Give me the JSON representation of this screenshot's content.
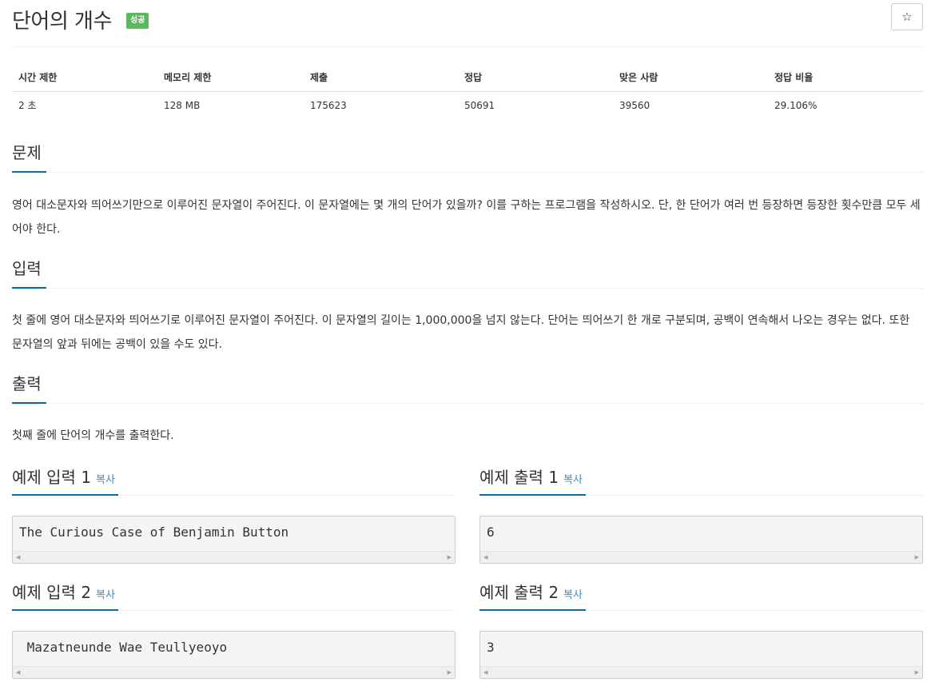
{
  "header": {
    "title": "단어의 개수",
    "badge": "성공",
    "star_icon": "☆"
  },
  "info_table": {
    "headers": [
      "시간 제한",
      "메모리 제한",
      "제출",
      "정답",
      "맞은 사람",
      "정답 비율"
    ],
    "values": [
      "2 초",
      "128 MB",
      "175623",
      "50691",
      "39560",
      "29.106%"
    ]
  },
  "sections": {
    "problem": {
      "title": "문제",
      "text": "영어 대소문자와 띄어쓰기만으로 이루어진 문자열이 주어진다. 이 문자열에는 몇 개의 단어가 있을까? 이를 구하는 프로그램을 작성하시오. 단, 한 단어가 여러 번 등장하면 등장한 횟수만큼 모두 세어야 한다."
    },
    "input": {
      "title": "입력",
      "text": "첫 줄에 영어 대소문자와 띄어쓰기로 이루어진 문자열이 주어진다. 이 문자열의 길이는 1,000,000을 넘지 않는다. 단어는 띄어쓰기 한 개로 구분되며, 공백이 연속해서 나오는 경우는 없다. 또한 문자열의 앞과 뒤에는 공백이 있을 수도 있다."
    },
    "output": {
      "title": "출력",
      "text": "첫째 줄에 단어의 개수를 출력한다."
    }
  },
  "examples": [
    {
      "input_title": "예제 입력 1",
      "output_title": "예제 출력 1",
      "input": "The Curious Case of Benjamin Button",
      "output": "6"
    },
    {
      "input_title": "예제 입력 2",
      "output_title": "예제 출력 2",
      "input": " Mazatneunde Wae Teullyeoyo",
      "output": "3"
    }
  ],
  "copy_label": "복사",
  "scroll_left": "◀",
  "scroll_right": "▶"
}
